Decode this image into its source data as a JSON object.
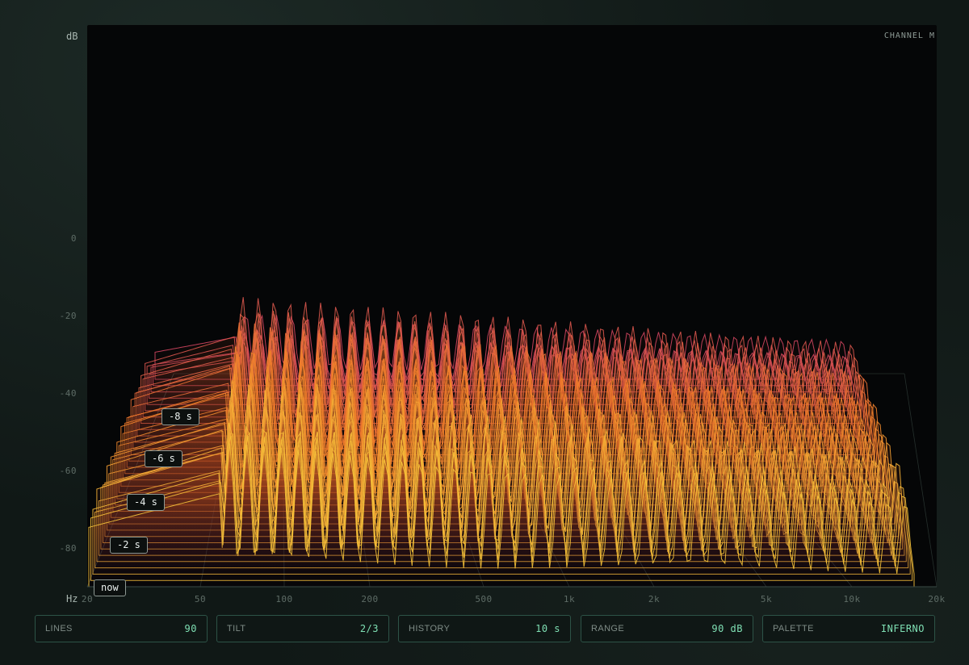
{
  "header": {
    "channel": "CHANNEL M"
  },
  "axis": {
    "y_unit": "dB",
    "x_unit": "Hz",
    "y_ticks": [
      "0",
      "-20",
      "-40",
      "-60",
      "-80"
    ],
    "x_ticks": [
      "20",
      "50",
      "100",
      "200",
      "500",
      "1k",
      "2k",
      "5k",
      "10k",
      "20k"
    ]
  },
  "time_labels": [
    "now",
    "-2 s",
    "-4 s",
    "-6 s",
    "-8 s"
  ],
  "controls": [
    {
      "label": "LINES",
      "value": "90"
    },
    {
      "label": "TILT",
      "value": "2/3"
    },
    {
      "label": "HISTORY",
      "value": "10 s"
    },
    {
      "label": "RANGE",
      "value": "90 dB"
    },
    {
      "label": "PALETTE",
      "value": "INFERNO"
    }
  ],
  "colors": {
    "accent": "#7fe0b4",
    "border": "#2d5347",
    "palette": [
      "#2a0b4a",
      "#7a1f8a",
      "#c8386e",
      "#f07a2a",
      "#f6c33a"
    ]
  }
}
